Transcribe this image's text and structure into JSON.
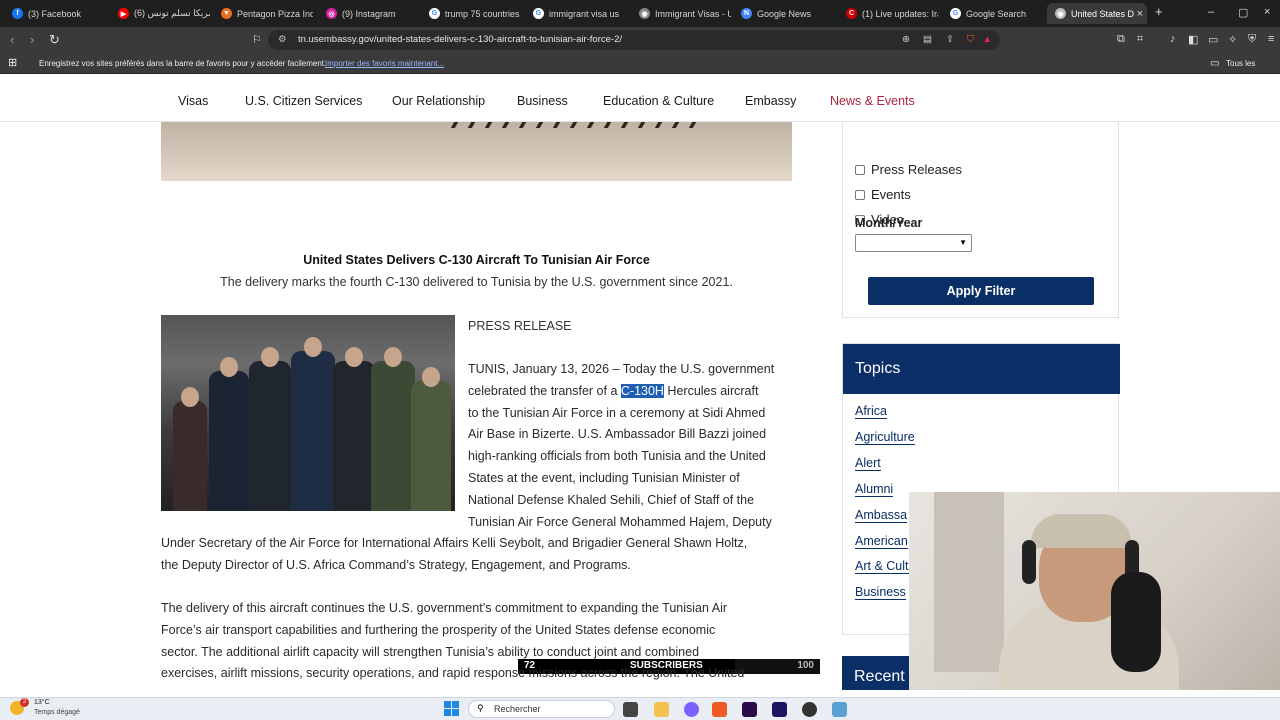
{
  "browser": {
    "tabs": [
      {
        "label": "(3) Facebook",
        "color": "#1877f2",
        "icon": "facebook-icon",
        "glyph": "f"
      },
      {
        "label": "(6) أمريكا تسلم تونس",
        "color": "#ff0000",
        "icon": "youtube-icon",
        "glyph": "▶"
      },
      {
        "label": "Pentagon Pizza Inde",
        "color": "#e8711c",
        "icon": "pizza-icon",
        "glyph": "▼"
      },
      {
        "label": "(9) Instagram",
        "color": "#d6249f",
        "icon": "instagram-icon",
        "glyph": "◎"
      },
      {
        "label": "trump 75 countries",
        "color": "#ffffff",
        "icon": "google-icon",
        "glyph": "G"
      },
      {
        "label": "immigrant visa us",
        "color": "#ffffff",
        "icon": "google-icon",
        "glyph": "G"
      },
      {
        "label": "Immigrant Visas - U",
        "color": "#888888",
        "icon": "site-icon",
        "glyph": "◉"
      },
      {
        "label": "Google News",
        "color": "#4285f4",
        "icon": "google-news-icon",
        "glyph": "N"
      },
      {
        "label": "(1) Live updates: Ira",
        "color": "#cc0000",
        "icon": "cnn-icon",
        "glyph": "C"
      },
      {
        "label": "Google Search",
        "color": "#ffffff",
        "icon": "google-icon",
        "glyph": "G"
      },
      {
        "label": "United States D",
        "color": "#bbbbbb",
        "icon": "site-icon",
        "glyph": "◉"
      }
    ],
    "url": "tn.usembassy.gov/united-states-delivers-c-130-aircraft-to-tunisian-air-force-2/",
    "bookmarks_prompt": "Enregistrez vos sites préférés dans la barre de favoris pour y accéder facilement.",
    "bookmarks_import": "Importer des favoris maintenant...",
    "bookmarks_all": "Tous les favoris"
  },
  "site_nav": [
    "Visas",
    "U.S. Citizen Services",
    "Our Relationship",
    "Business",
    "Education & Culture",
    "Embassy",
    "News & Events"
  ],
  "article": {
    "title": "United States Delivers C-130 Aircraft To Tunisian Air Force",
    "subtitle": "The delivery marks the fourth C-130 delivered to Tunisia by the U.S. government since 2021.",
    "label": "PRESS RELEASE",
    "p1_lines": [
      "TUNIS, January 13, 2026 – Today the U.S. government",
      "celebrated the transfer of a ",
      "to the Tunisian Air Force in a ceremony at Sidi Ahmed",
      "Air Base in Bizerte. U.S. Ambassador Bill Bazzi joined",
      "high-ranking officials from both Tunisia and the United",
      "States at the event, including Tunisian Minister of",
      "National Defense Khaled Sehili, Chief of Staff of the",
      "Tunisian Air Force General Mohammed Hajem, Deputy"
    ],
    "p1_highlight": "C-130H",
    "p1_after_highlight": " Hercules aircraft",
    "p1_full_lines": [
      "Under Secretary of the Air Force for International Affairs Kelli Seybolt, and Brigadier General Shawn Holtz,",
      "the Deputy Director of U.S. Africa Command’s Strategy, Engagement, and Programs."
    ],
    "p2_lines": [
      "The delivery of this aircraft continues the U.S. government’s commitment to expanding the Tunisian Air",
      "Force’s air transport capabilities and furthering the prosperity of the United States defense economic",
      "sector. The additional airlift capacity will strengthen Tunisia’s ability to conduct joint and combined",
      "exercises, airlift missions, security operations, and rapid response missions across the region. The United"
    ]
  },
  "filters": {
    "options": [
      "Press Releases",
      "Events",
      "Video"
    ],
    "month_label": "Month/Year",
    "apply_label": "Apply Filter"
  },
  "topics": {
    "heading": "Topics",
    "items": [
      "Africa",
      "Agriculture",
      "Alert",
      "Alumni",
      "Ambassa",
      "American",
      "Art & Cult",
      "Business"
    ]
  },
  "recent_heading": "Recent P",
  "overlay": {
    "subscribers_count": "72",
    "subscribers_label": "SUBSCRIBERS",
    "subscribers_goal": "100",
    "subscribers_progress": 0.72
  },
  "taskbar": {
    "temp": "13°C",
    "weather": "Temps dégagé",
    "search_placeholder": "Rechercher",
    "badge": "2"
  }
}
